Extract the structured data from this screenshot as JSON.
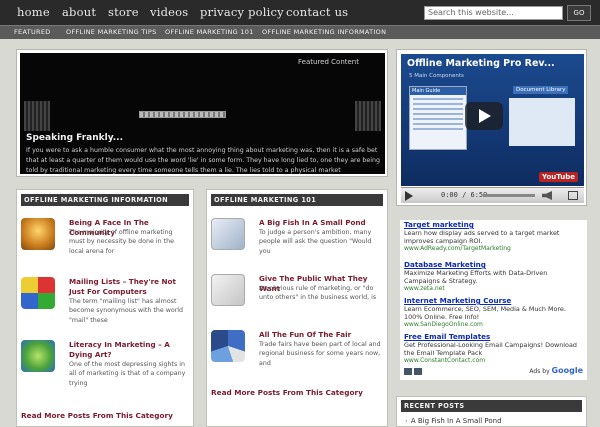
{
  "nav": {
    "items": [
      "home",
      "about",
      "store",
      "videos",
      "privacy policy",
      "contact us"
    ],
    "search_placeholder": "Search this website...",
    "search_button": "GO"
  },
  "categories": [
    "FEATURED",
    "OFFLINE MARKETING TIPS",
    "OFFLINE MARKETING 101",
    "OFFLINE MARKETING INFORMATION"
  ],
  "featured": {
    "label": "Featured Content",
    "title": "Speaking Frankly...",
    "text": "If you were to ask a humble consumer what the most annoying thing about marketing was, then it is a safe bet that at least a quarter of them would use the word 'lie' in some form. They have long lied to, one they are being told by traditional marketing every time someone tells them a lie. The lies told to a physical market"
  },
  "video": {
    "title": "Offline Marketing Pro Rev...",
    "subtitle": "5 Main Components",
    "left_header": "Main Guide",
    "library_label": "Document Library",
    "time": "0:00 / 6:59",
    "logo": "YouTube"
  },
  "sections": [
    {
      "heading": "OFFLINE MARKETING INFORMATION",
      "more": "Read More Posts From This Category",
      "posts": [
        {
          "title": "Being A Face In The Community",
          "text": "The majority of offline marketing must by necessity be done in the local arena for"
        },
        {
          "title": "Mailing Lists – They're Not Just For Computers",
          "text": "The term \"mailing list\" has almost become synonymous with the world \"mail\" these"
        },
        {
          "title": "Literacy In Marketing – A Dying Art?",
          "text": "One of the most depressing sights in all of marketing is that of a company trying"
        }
      ]
    },
    {
      "heading": "OFFLINE MARKETING 101",
      "more": "Read More Posts From This Category",
      "posts": [
        {
          "title": "A Big Fish In A Small Pond",
          "text": "To judge a person's ambition, many people will ask the question \"Would you"
        },
        {
          "title": "Give The Public What They Want",
          "text": "An obvious rule of marketing, or \"do unto others\" in the business world, is"
        },
        {
          "title": "All The Fun Of The Fair",
          "text": "Trade fairs have been part of local and regional business for some years now, and"
        }
      ]
    }
  ],
  "ads": [
    {
      "title": "Target marketing",
      "text": "Learn how display ads served to a target market improves campaign ROI.",
      "url": "www.AdReady.com/TargetMarketing"
    },
    {
      "title": "Database Marketing",
      "text": "Maximize Marketing Efforts with Data-Driven Campaigns & Strategy.",
      "url": "www.zeta.net"
    },
    {
      "title": "Internet Marketing Course",
      "text": "Learn Ecommerce, SEO, SEM, Media & Much More. 100% Online. Free Info!",
      "url": "www.SanDiegoOnline.com"
    },
    {
      "title": "Free Email Templates",
      "text": "Get Professional-Looking Email Campaigns! Download the Email Template Pack",
      "url": "www.ConstantContact.com"
    }
  ],
  "ads_by": {
    "label": "Ads by",
    "brand": "Google"
  },
  "recent": {
    "heading": "RECENT POSTS",
    "items": [
      "A Big Fish In A Small Pond"
    ]
  }
}
